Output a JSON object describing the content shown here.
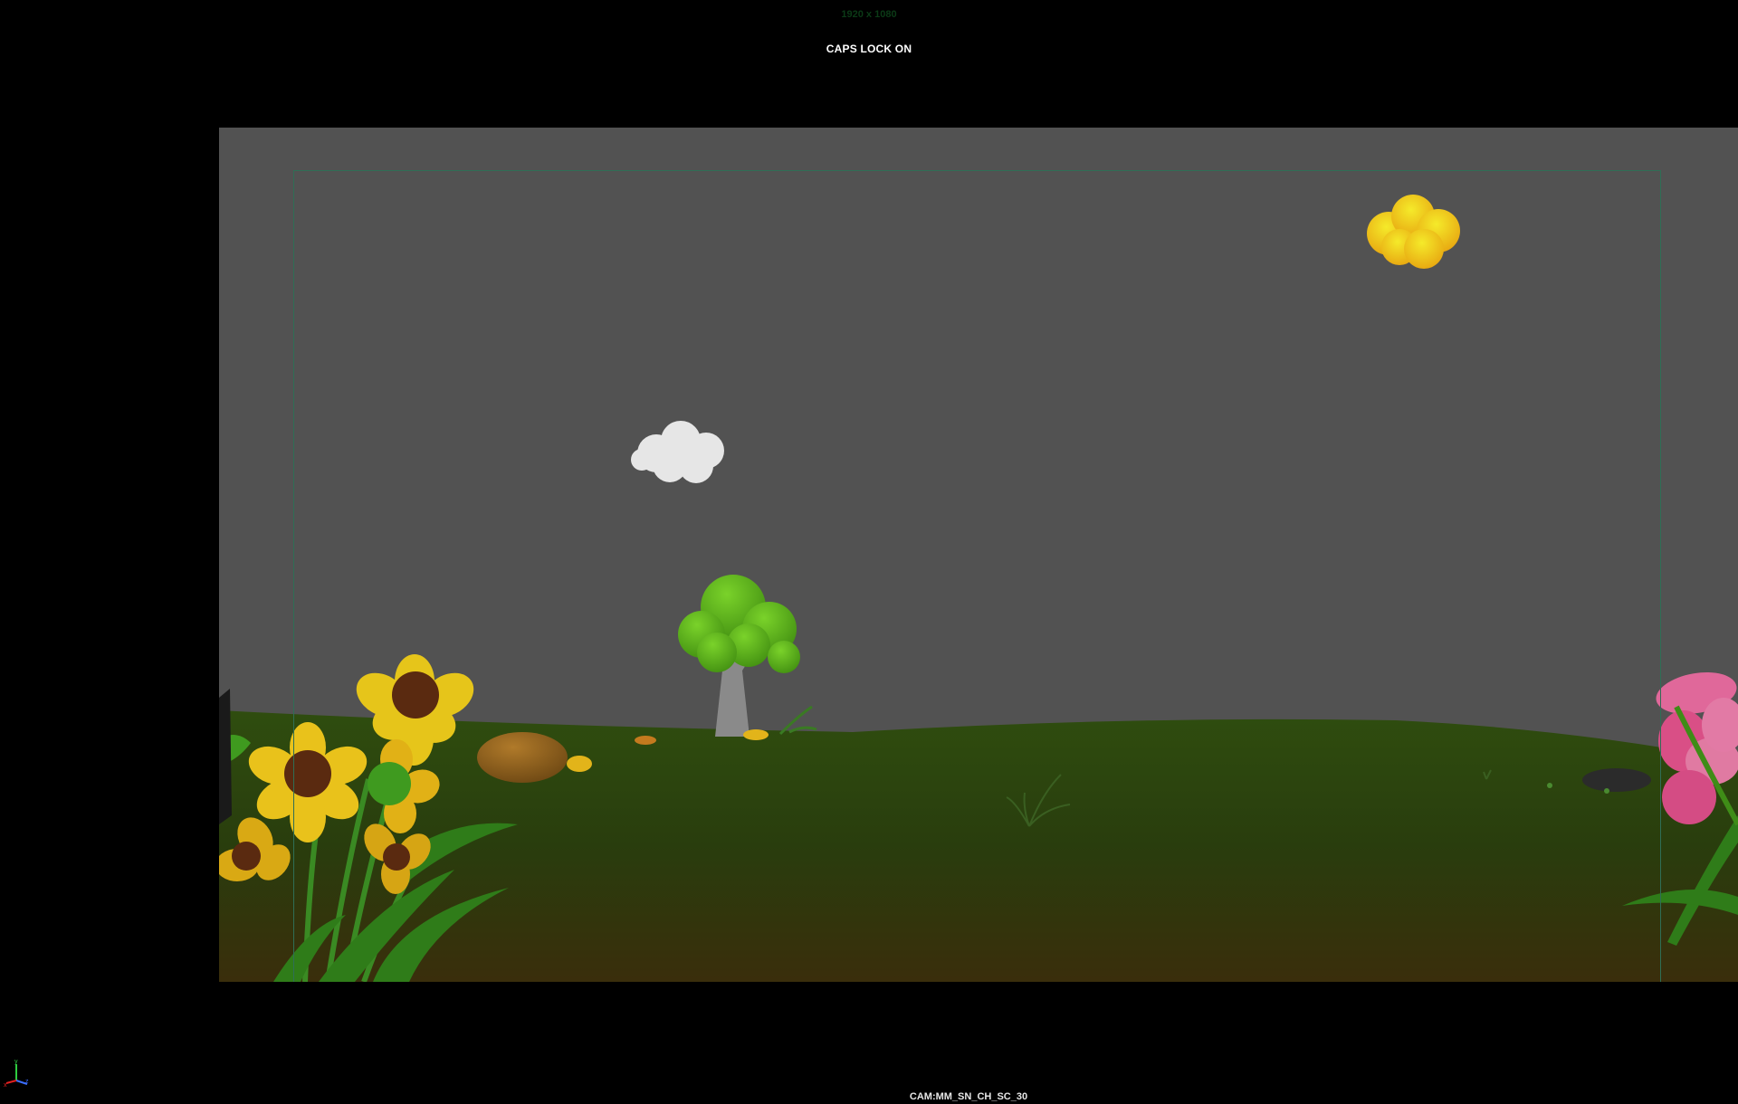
{
  "viewport": {
    "resolution_gate_label": "1920 x 1080",
    "hud_message": "CAPS LOCK ON",
    "camera_name": "CAM:MM_SN_CH_SC_30",
    "background_color": "#525252",
    "gate_color": "#2f6e55"
  },
  "axis_gizmo": {
    "x_label": "x",
    "y_label": "y",
    "z_label": "z"
  },
  "scene_objects": [
    "yellow-cloud",
    "white-cloud",
    "cartoon-tree",
    "ground-hill",
    "boulder",
    "sunflower-cluster",
    "pink-flower",
    "grass-tuft",
    "dark-rock"
  ]
}
